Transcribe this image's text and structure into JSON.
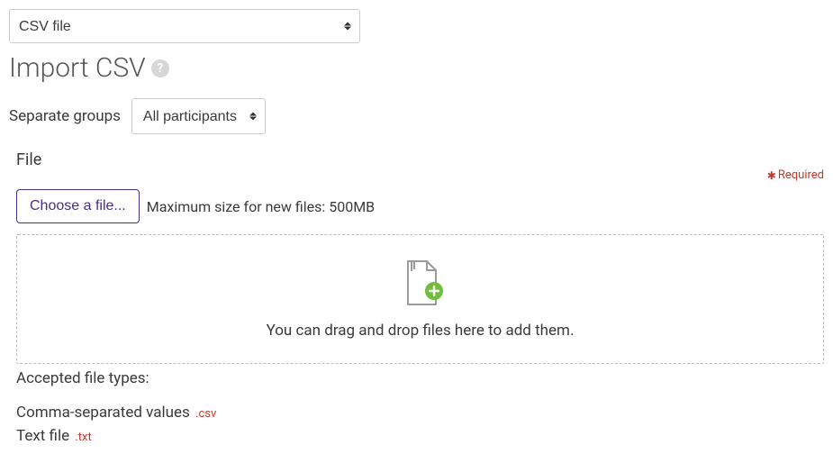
{
  "format_select": {
    "value": "CSV file"
  },
  "page_title": "Import CSV",
  "groups": {
    "label": "Separate groups",
    "value": "All participants"
  },
  "file": {
    "label": "File",
    "required_text": "Required",
    "choose_button": "Choose a file...",
    "max_size": "Maximum size for new files: 500MB",
    "drop_hint": "You can drag and drop files here to add them."
  },
  "accepted": {
    "label": "Accepted file types:",
    "types": [
      {
        "name": "Comma-separated values",
        "ext": ".csv"
      },
      {
        "name": "Text file",
        "ext": ".txt"
      }
    ]
  }
}
